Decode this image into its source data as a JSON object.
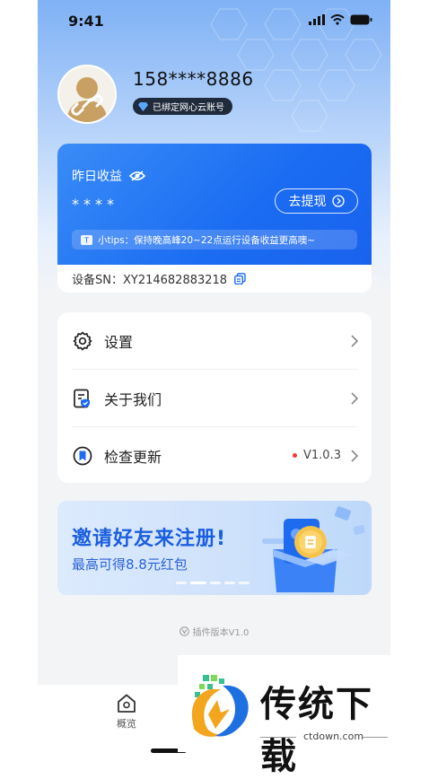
{
  "status_bar": {
    "time": "9:41"
  },
  "profile": {
    "phone": "158****8886",
    "bind_badge": "已绑定网心云账号"
  },
  "earnings": {
    "label": "昨日收益",
    "value": "****",
    "withdraw_label": "去提现",
    "tips": "小tips：保持晚高峰20~22点运行设备收益更高噢~",
    "device_sn": "设备SN：XY214682883218"
  },
  "menu": {
    "items": [
      {
        "label": "设置"
      },
      {
        "label": "关于我们"
      },
      {
        "label": "检查更新",
        "version": "V1.0.3"
      }
    ]
  },
  "banner": {
    "title": "邀请好友来注册!",
    "subtitle": "最高可得8.8元红包"
  },
  "plugin_version": "插件版本V1.0",
  "tabbar": {
    "tabs": [
      {
        "label": "概览"
      }
    ]
  },
  "watermark": {
    "name": "传统下载",
    "url": "ctdown.com"
  },
  "colors": {
    "primary": "#1b6cf2",
    "badge_bg": "#1f2a3a",
    "update_dot": "#f03c3c"
  }
}
